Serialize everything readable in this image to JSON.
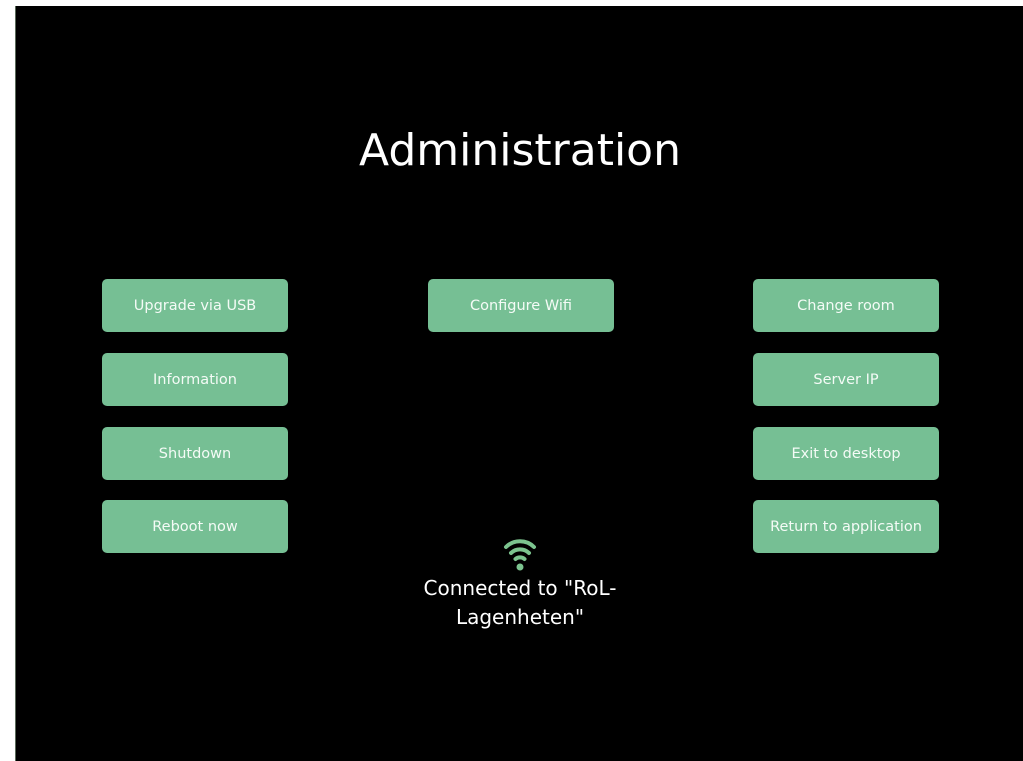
{
  "title": "Administration",
  "buttons": {
    "upgrade_usb": "Upgrade via USB",
    "configure_wifi": "Configure Wifi",
    "change_room": "Change room",
    "information": "Information",
    "server_ip": "Server IP",
    "shutdown": "Shutdown",
    "exit_desktop": "Exit to desktop",
    "reboot": "Reboot now",
    "return_app": "Return to application"
  },
  "wifi": {
    "icon": "wifi-icon",
    "status_text": "Connected to \"RoL-Lagenheten\""
  },
  "colors": {
    "background": "#000000",
    "button": "#76bf94",
    "wifi_icon": "#7cc48f",
    "text": "#ffffff"
  }
}
